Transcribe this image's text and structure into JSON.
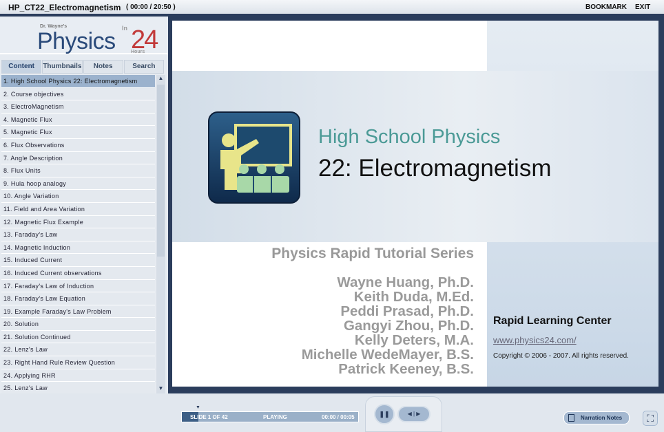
{
  "title": {
    "name": "HP_CT22_Electromagnetism",
    "time": "( 00:00 / 20:50 )",
    "bookmark": "BOOKMARK",
    "exit": "EXIT"
  },
  "logo": {
    "dr": "Dr. Wayne's",
    "physics": "Physics",
    "in": "In",
    "num": "24",
    "hours": "Hours"
  },
  "tabs": [
    "Content",
    "Thumbnails",
    "Notes",
    "Search"
  ],
  "items": [
    "1. High School Physics 22: Electromagnetism",
    "2. Course objectives",
    "3. ElectroMagnetism",
    "4. Magnetic Flux",
    "5. Magnetic Flux",
    "6. Flux Observations",
    "7. Angle Description",
    "8. Flux Units",
    "9. Hula hoop analogy",
    "10. Angle Variation",
    "11. Field and Area Variation",
    "12. Magnetic Flux Example",
    "13. Faraday's Law",
    "14. Magnetic Induction",
    "15. Induced Current",
    "16. Induced Current observations",
    "17. Faraday's Law of Induction",
    "18. Faraday's Law Equation",
    "19. Example Faraday's Law Problem",
    "20. Solution",
    "21. Solution Continued",
    "22. Lenz's Law",
    "23. Right Hand Rule Review Question",
    "24. Applying RHR",
    "25. Lenz's Law"
  ],
  "slide": {
    "heading1": "High School Physics",
    "heading2": "22: Electromagnetism",
    "series": "Physics Rapid Tutorial Series",
    "authors": [
      "Wayne Huang, Ph.D.",
      "Keith Duda, M.Ed.",
      "Peddi Prasad, Ph.D.",
      "Gangyi Zhou, Ph.D.",
      "Kelly Deters, M.A.",
      "Michelle WedeMayer, B.S.",
      "Patrick Keeney, B.S."
    ],
    "center": "Rapid Learning Center",
    "url": "www.physics24.com/",
    "copyright": "Copyright © 2006 - 2007. All rights reserved."
  },
  "player": {
    "slide": "SLIDE 1 OF 42",
    "status": "PLAYING",
    "time": "00:00 / 00:05",
    "progress": 0.0,
    "notes": "Narration Notes"
  }
}
